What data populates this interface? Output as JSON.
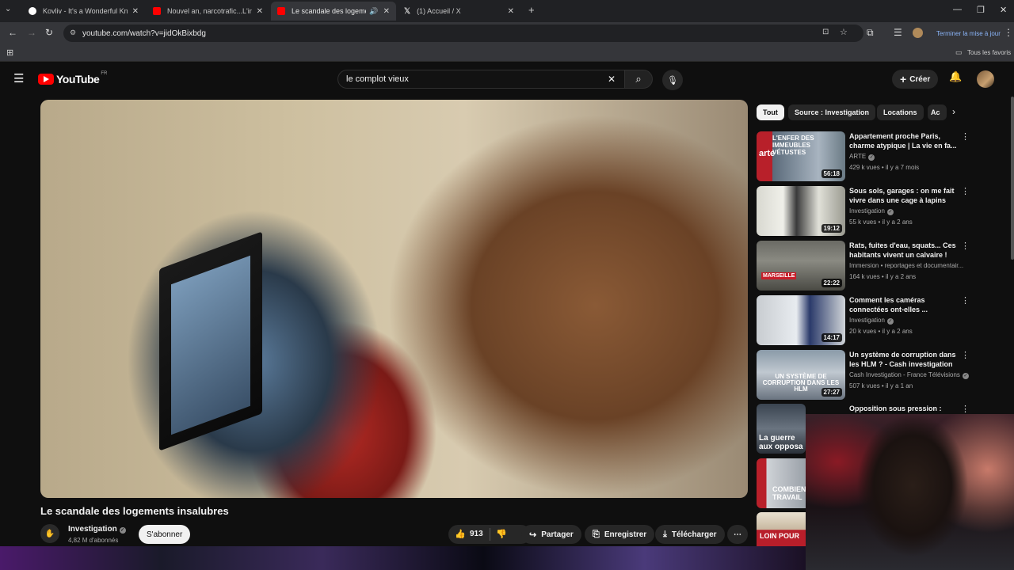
{
  "browser": {
    "tabs": [
      {
        "title": "Kovliv - It's a Wonderful Knife (",
        "favicon_color": "#ffffff"
      },
      {
        "title": "Nouvel an, narcotrafic...L'interv",
        "favicon_color": "#ff0000"
      },
      {
        "title": "Le scandale des logements",
        "favicon_color": "#ff0000"
      },
      {
        "title": "(1) Accueil / X",
        "favicon_color": "#ffffff"
      }
    ],
    "url": "youtube.com/watch?v=jidOkBixbdg",
    "update_button": "Terminer la mise à jour",
    "bookmarks_label": "Tous les favoris"
  },
  "youtube": {
    "logo_text": "YouTube",
    "country_code": "FR",
    "search_value": "le complot vieux",
    "create_label": "Créer",
    "video": {
      "title": "Le scandale des logements insalubres",
      "channel": "Investigation",
      "subscribers": "4,82 M d'abonnés",
      "subscribe_label": "S'abonner",
      "likes": "913",
      "share_label": "Partager",
      "save_label": "Enregistrer",
      "download_label": "Télécharger"
    },
    "chips": [
      "Tout",
      "Source : Investigation",
      "Locations",
      "Ac"
    ],
    "recommendations": [
      {
        "title": "Appartement proche Paris, charme atypique | La vie en fa...",
        "channel": "ARTE",
        "meta": "429 k vues • il y a 7 mois",
        "duration": "56:18",
        "thumb_text": "L'ENFER DES IMMEUBLES VÉTUSTES"
      },
      {
        "title": "Sous sols, garages : on me fait vivre dans une cage à lapins",
        "channel": "Investigation",
        "meta": "55 k vues • il y a 2 ans",
        "duration": "19:12",
        "thumb_text": ""
      },
      {
        "title": "Rats, fuites d'eau, squats... Ces habitants vivent un calvaire !",
        "channel": "Immersion • reportages et documentair...",
        "meta": "164 k vues • il y a 2 ans",
        "duration": "22:22",
        "thumb_text": "MARSEILLE"
      },
      {
        "title": "Comment les caméras connectées ont-elles ...",
        "channel": "Investigation",
        "meta": "20 k vues • il y a 2 ans",
        "duration": "14:17",
        "thumb_text": ""
      },
      {
        "title": "Un système de corruption dans les HLM ? - Cash investigation",
        "channel": "Cash Investigation - France Télévisions",
        "meta": "507 k vues • il y a 1 an",
        "duration": "27:27",
        "thumb_text": "UN SYSTÈME DE CORRUPTION DANS LES HLM"
      },
      {
        "title": "Opposition sous pression :",
        "channel": "",
        "meta": "",
        "duration": "",
        "thumb_text": "La guerre aux opposa"
      }
    ],
    "extra_thumbs": [
      "COMBIEN TRAVAIL",
      "LOIN POUR"
    ]
  }
}
